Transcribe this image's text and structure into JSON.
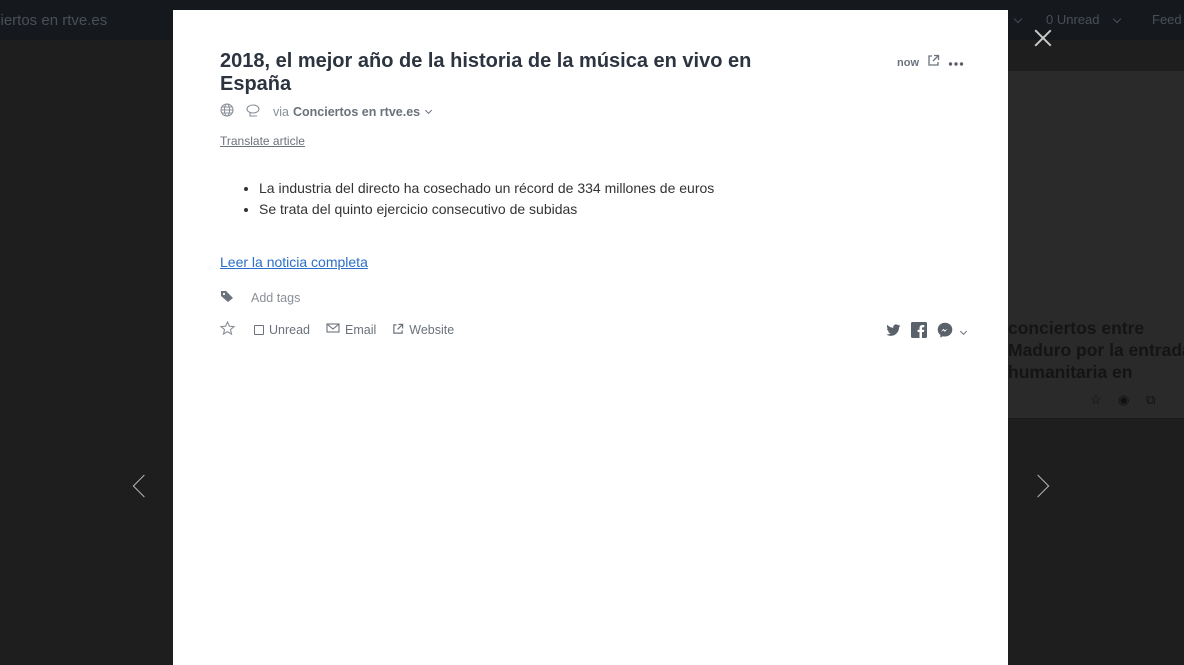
{
  "background": {
    "feed_name": "Conciertos en rtve.es",
    "unread_count": "0 Unread",
    "feed_menu": "Feed",
    "card_title_lines": [
      "conciertos entre",
      "Maduro por la entrada",
      "humanitaria en"
    ]
  },
  "article": {
    "title": "2018, el mejor año de la historia de la música en vivo en España",
    "time": "now",
    "via_prefix": "via",
    "source": "Conciertos en rtve.es",
    "translate_label": "Translate article",
    "bullets": [
      "La industria del directo ha cosechado un récord de 334 millones de euros",
      "Se trata del quinto ejercicio consecutivo de subidas"
    ],
    "read_more_label": "Leer la noticia completa",
    "add_tags_label": "Add tags",
    "actions": {
      "unread": "Unread",
      "email": "Email",
      "website": "Website"
    }
  },
  "icons": {
    "open_external": "external-link-icon",
    "more": "more-icon",
    "globe": "globe-icon",
    "feed": "feed-icon",
    "tag": "tag-icon",
    "star": "star-icon",
    "twitter": "twitter-icon",
    "facebook": "facebook-icon",
    "messenger": "messenger-icon"
  },
  "colors": {
    "link": "#2a6fc9",
    "title": "#2c3440",
    "muted": "#6b727c"
  }
}
